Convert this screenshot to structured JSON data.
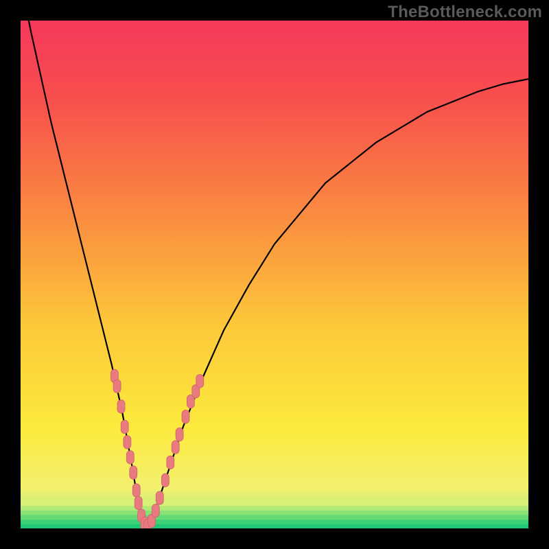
{
  "watermark": "TheBottleneck.com",
  "colors": {
    "frame": "#000000",
    "curve": "#000000",
    "marker_fill": "#e97b80",
    "marker_stroke": "#d06a70"
  },
  "chart_data": {
    "type": "line",
    "title": "",
    "xlabel": "",
    "ylabel": "",
    "xlim": [
      0,
      100
    ],
    "ylim": [
      0,
      100
    ],
    "grid": false,
    "gradient_bands": [
      {
        "y": 0,
        "color": "#28d47a"
      },
      {
        "y": 2,
        "color": "#7ae07a"
      },
      {
        "y": 4,
        "color": "#c8ec78"
      },
      {
        "y": 8,
        "color": "#f3f06e"
      },
      {
        "y": 20,
        "color": "#fcea3c"
      },
      {
        "y": 40,
        "color": "#fdc83a"
      },
      {
        "y": 55,
        "color": "#fb9e3e"
      },
      {
        "y": 70,
        "color": "#f97544"
      },
      {
        "y": 85,
        "color": "#f84e4e"
      },
      {
        "y": 100,
        "color": "#f5395b"
      }
    ],
    "series": [
      {
        "name": "bottleneck-curve",
        "x": [
          0,
          2,
          4,
          6,
          8,
          10,
          12,
          14,
          16,
          18,
          20,
          22,
          23,
          24,
          25,
          26,
          28,
          30,
          32,
          36,
          40,
          45,
          50,
          55,
          60,
          65,
          70,
          75,
          80,
          85,
          90,
          95,
          100
        ],
        "y": [
          108,
          98,
          89,
          80,
          72,
          64,
          56,
          48,
          40,
          32,
          23,
          12,
          6,
          2,
          0.5,
          2,
          8,
          14,
          20,
          30,
          39,
          48,
          56,
          62,
          68,
          72,
          76,
          79,
          82,
          84,
          86,
          87.5,
          88.5
        ]
      }
    ],
    "markers": [
      {
        "x": 18.5,
        "y": 30
      },
      {
        "x": 19.0,
        "y": 28
      },
      {
        "x": 19.8,
        "y": 24
      },
      {
        "x": 20.5,
        "y": 20
      },
      {
        "x": 21.0,
        "y": 17
      },
      {
        "x": 21.6,
        "y": 14
      },
      {
        "x": 22.2,
        "y": 11
      },
      {
        "x": 22.8,
        "y": 7.5
      },
      {
        "x": 23.2,
        "y": 5
      },
      {
        "x": 23.8,
        "y": 2.5
      },
      {
        "x": 24.4,
        "y": 1
      },
      {
        "x": 25.0,
        "y": 0.5
      },
      {
        "x": 25.8,
        "y": 1.5
      },
      {
        "x": 26.6,
        "y": 3.5
      },
      {
        "x": 27.4,
        "y": 6
      },
      {
        "x": 28.5,
        "y": 9.5
      },
      {
        "x": 29.5,
        "y": 13
      },
      {
        "x": 30.5,
        "y": 16
      },
      {
        "x": 31.3,
        "y": 18.5
      },
      {
        "x": 32.5,
        "y": 22
      },
      {
        "x": 33.5,
        "y": 25
      },
      {
        "x": 34.5,
        "y": 27
      },
      {
        "x": 35.3,
        "y": 29
      }
    ],
    "marker_size": 12
  }
}
